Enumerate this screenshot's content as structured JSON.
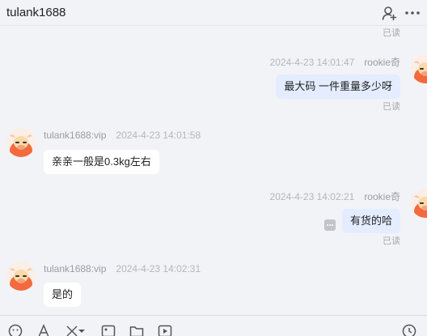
{
  "header": {
    "title": "tulank1688",
    "user_icon": "add-user-icon",
    "more_icon": "more-icon"
  },
  "messages": [
    {
      "side": "right",
      "sender": "",
      "time": "",
      "text": "",
      "read": "已读",
      "partial": true
    },
    {
      "side": "right",
      "sender": "rookie奇",
      "time": "2024-4-23 14:01:47",
      "text": "最大码 一件重量多少呀",
      "read": "已读"
    },
    {
      "side": "left",
      "sender": "tulank1688:vip",
      "time": "2024-4-23 14:01:58",
      "text": "亲亲一般是0.3kg左右"
    },
    {
      "side": "right",
      "sender": "rookie奇",
      "time": "2024-4-23 14:02:21",
      "text": "有货的哈",
      "read": "已读",
      "comment_icon": "comment-icon"
    },
    {
      "side": "left",
      "sender": "tulank1688:vip",
      "time": "2024-4-23 14:02:31",
      "text": "是的"
    }
  ],
  "toolbar": {
    "icons": [
      "emoji-icon",
      "font-icon",
      "scissors-icon",
      "dropdown-icon",
      "image-icon",
      "folder-icon",
      "video-icon",
      "history-icon"
    ]
  },
  "colors": {
    "background": "#f2f3f6",
    "bubble_out": "#e3edff",
    "bubble_in": "#ffffff",
    "avatar": "#f26a3d"
  }
}
